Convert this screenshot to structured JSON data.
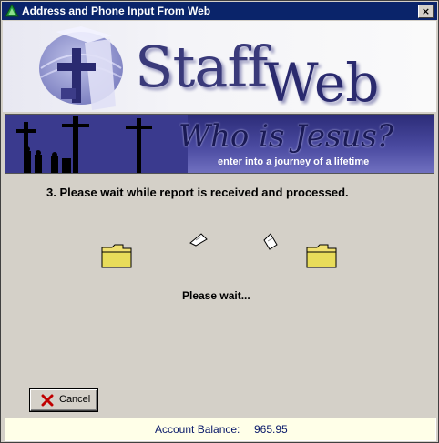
{
  "window": {
    "title": "Address and Phone Input From Web",
    "close_glyph": "×"
  },
  "logo": {
    "word1": "Staff",
    "word2": "Web"
  },
  "banner": {
    "script_text": "Who is Jesus?",
    "subtitle": "enter into a journey of a lifetime"
  },
  "main": {
    "step_text": "3.  Please wait while report is received and processed.",
    "wait_text": "Please wait..."
  },
  "buttons": {
    "cancel_label": "Cancel"
  },
  "status": {
    "label": "Account Balance:",
    "value": "965.95"
  },
  "colors": {
    "titlebar": "#0a246a",
    "window_bg": "#d4d0c8",
    "status_bg": "#ffffe8",
    "folder": "#f0e070"
  },
  "icons": {
    "app": "green-triangle-icon",
    "close": "close-icon",
    "cancel": "red-x-icon",
    "source_folder": "folder-icon",
    "target_folder": "folder-icon",
    "flying_doc": "document-icon"
  }
}
